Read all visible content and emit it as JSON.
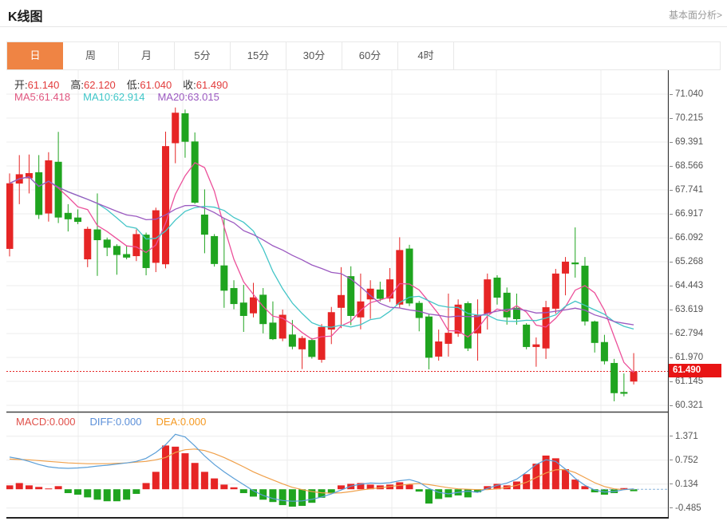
{
  "header": {
    "title": "K线图",
    "link": "基本面分析>"
  },
  "tabs": {
    "items": [
      "日",
      "周",
      "月",
      "5分",
      "15分",
      "30分",
      "60分",
      "4时"
    ],
    "active_index": 0,
    "active_bg": "#ef8444"
  },
  "legend": {
    "ohlc": [
      {
        "label": "开:",
        "value": "61.140"
      },
      {
        "label": "高:",
        "value": "62.120"
      },
      {
        "label": "低:",
        "value": "61.040"
      },
      {
        "label": "收:",
        "value": "61.490"
      }
    ],
    "ma": [
      {
        "label": "MA5:",
        "value": "61.418",
        "color": "#e0557f"
      },
      {
        "label": "MA10:",
        "value": "62.914",
        "color": "#3fc6c8"
      },
      {
        "label": "MA20:",
        "value": "63.015",
        "color": "#9b59c0"
      }
    ],
    "macd": [
      {
        "label": "MACD:",
        "value": "0.000",
        "color": "#e0504a"
      },
      {
        "label": "DIFF:",
        "value": "0.000",
        "color": "#5b8fd8"
      },
      {
        "label": "DEA:",
        "value": "0.000",
        "color": "#f59a23"
      }
    ]
  },
  "axis": {
    "main_tick_labels": [
      "71.040",
      "70.215",
      "69.391",
      "68.566",
      "67.741",
      "66.917",
      "66.092",
      "65.268",
      "64.443",
      "63.619",
      "62.794",
      "61.970",
      "61.145",
      "60.321"
    ],
    "macd_tick_labels": [
      "1.371",
      "0.752",
      "0.134",
      "-0.485"
    ],
    "current_price_label": "61.490"
  },
  "colors": {
    "up": "#e62525",
    "down": "#1fa41f",
    "grid": "#ececec",
    "axis_line": "#333333",
    "dotted_price": "#e62525",
    "badge_bg": "#e81414",
    "ma5": "#ec509a",
    "ma10": "#43c5c7",
    "ma20": "#9b59c0",
    "diff": "#5b9fd8",
    "dea": "#f0a04a"
  },
  "chart_data": {
    "type": "candlestick+macd",
    "title": "K线图 (daily K-line with MA5/MA10/MA20 overlays and MACD pane)",
    "price_axis": {
      "ticks": [
        71.04,
        70.215,
        69.391,
        68.566,
        67.741,
        66.917,
        66.092,
        65.268,
        64.443,
        63.619,
        62.794,
        61.97,
        61.145,
        60.321
      ],
      "current_price": 61.49
    },
    "macd_axis": {
      "ticks": [
        1.371,
        0.752,
        0.134,
        -0.485
      ]
    },
    "ohlc_latest": {
      "open": 61.14,
      "high": 62.12,
      "low": 61.04,
      "close": 61.49
    },
    "ma_latest": {
      "ma5": 61.418,
      "ma10": 62.914,
      "ma20": 63.015
    },
    "candles_ohlc": [
      [
        65.71,
        68.31,
        65.45,
        67.97
      ],
      [
        67.96,
        68.94,
        67.25,
        68.28
      ],
      [
        68.14,
        68.96,
        67.62,
        68.32
      ],
      [
        68.35,
        68.94,
        66.74,
        66.88
      ],
      [
        66.93,
        69.04,
        66.65,
        68.76
      ],
      [
        68.71,
        69.74,
        66.6,
        66.79
      ],
      [
        66.95,
        67.25,
        66.31,
        66.73
      ],
      [
        66.79,
        67.07,
        66.56,
        66.64
      ],
      [
        65.35,
        66.47,
        65.08,
        66.4
      ],
      [
        66.38,
        67.62,
        64.78,
        66.01
      ],
      [
        66.03,
        66.1,
        65.46,
        65.75
      ],
      [
        65.81,
        65.87,
        64.82,
        65.5
      ],
      [
        65.53,
        65.82,
        65.35,
        65.41
      ],
      [
        65.46,
        66.38,
        65.29,
        66.22
      ],
      [
        66.2,
        66.27,
        64.8,
        65.05
      ],
      [
        65.23,
        67.13,
        64.91,
        67.04
      ],
      [
        65.18,
        69.75,
        65.04,
        69.25
      ],
      [
        69.35,
        70.58,
        68.66,
        70.4
      ],
      [
        70.38,
        70.51,
        68.85,
        69.4
      ],
      [
        69.41,
        69.72,
        67.26,
        67.3
      ],
      [
        66.89,
        67.76,
        65.56,
        66.2
      ],
      [
        66.15,
        66.22,
        65.1,
        65.19
      ],
      [
        65.14,
        66.75,
        63.68,
        64.27
      ],
      [
        64.36,
        64.63,
        63.63,
        63.81
      ],
      [
        63.86,
        64.47,
        62.85,
        63.4
      ],
      [
        63.49,
        64.54,
        63.35,
        64.04
      ],
      [
        64.13,
        64.36,
        62.8,
        63.12
      ],
      [
        63.17,
        63.9,
        62.57,
        62.6
      ],
      [
        62.62,
        63.62,
        62.53,
        63.44
      ],
      [
        62.76,
        63.26,
        62.25,
        62.34
      ],
      [
        62.25,
        62.71,
        61.57,
        62.64
      ],
      [
        62.57,
        62.64,
        61.93,
        61.99
      ],
      [
        61.89,
        63.12,
        61.79,
        63.02
      ],
      [
        62.93,
        63.71,
        62.43,
        63.53
      ],
      [
        63.68,
        65.08,
        62.98,
        64.12
      ],
      [
        64.77,
        65.11,
        63.08,
        63.4
      ],
      [
        63.35,
        64.86,
        62.94,
        63.9
      ],
      [
        63.97,
        64.63,
        63.3,
        64.34
      ],
      [
        64.31,
        64.58,
        63.9,
        63.99
      ],
      [
        64.0,
        65.05,
        63.88,
        64.66
      ],
      [
        63.79,
        66.11,
        63.67,
        65.67
      ],
      [
        65.72,
        65.85,
        63.74,
        63.83
      ],
      [
        63.85,
        63.92,
        62.87,
        63.33
      ],
      [
        63.38,
        63.47,
        61.56,
        61.96
      ],
      [
        62.0,
        62.93,
        61.86,
        62.52
      ],
      [
        62.44,
        64.17,
        62.0,
        62.82
      ],
      [
        62.79,
        63.97,
        62.68,
        63.79
      ],
      [
        63.84,
        63.9,
        62.19,
        62.28
      ],
      [
        62.8,
        63.97,
        61.86,
        63.43
      ],
      [
        63.48,
        64.86,
        62.93,
        64.66
      ],
      [
        64.72,
        64.8,
        63.79,
        64.03
      ],
      [
        64.2,
        64.38,
        63.1,
        63.35
      ],
      [
        63.68,
        64.17,
        63.1,
        63.29
      ],
      [
        63.1,
        63.15,
        62.25,
        62.33
      ],
      [
        62.33,
        62.66,
        61.65,
        62.42
      ],
      [
        62.28,
        63.92,
        61.92,
        63.7
      ],
      [
        63.65,
        65.02,
        63.48,
        64.86
      ],
      [
        64.86,
        65.43,
        64.11,
        65.27
      ],
      [
        65.24,
        66.45,
        64.72,
        65.18
      ],
      [
        65.13,
        65.43,
        63.07,
        63.21
      ],
      [
        63.21,
        63.24,
        62.14,
        62.47
      ],
      [
        62.5,
        62.75,
        61.73,
        61.84
      ],
      [
        61.78,
        61.92,
        60.46,
        60.74
      ],
      [
        60.78,
        61.42,
        60.63,
        60.72
      ],
      [
        61.14,
        62.12,
        61.04,
        61.49
      ]
    ],
    "macd": {
      "hist": [
        0.1,
        0.16,
        0.1,
        0.06,
        0.02,
        0.08,
        -0.1,
        -0.14,
        -0.21,
        -0.27,
        -0.31,
        -0.31,
        -0.27,
        -0.12,
        0.16,
        0.45,
        1.13,
        1.1,
        0.93,
        0.68,
        0.45,
        0.28,
        0.12,
        0.05,
        -0.1,
        -0.19,
        -0.27,
        -0.33,
        -0.41,
        -0.45,
        -0.43,
        -0.35,
        -0.22,
        -0.1,
        0.1,
        0.14,
        0.16,
        0.12,
        0.1,
        0.12,
        0.18,
        0.12,
        -0.06,
        -0.37,
        -0.25,
        -0.21,
        -0.16,
        -0.21,
        -0.08,
        0.08,
        0.14,
        0.1,
        0.2,
        0.39,
        0.66,
        0.87,
        0.8,
        0.52,
        0.25,
        0.08,
        -0.08,
        -0.14,
        -0.1,
        0.03,
        -0.05
      ],
      "diff": [
        0.83,
        0.79,
        0.72,
        0.64,
        0.58,
        0.55,
        0.54,
        0.55,
        0.57,
        0.6,
        0.62,
        0.65,
        0.68,
        0.72,
        0.8,
        0.95,
        1.15,
        1.42,
        1.35,
        1.12,
        0.86,
        0.64,
        0.45,
        0.28,
        0.12,
        -0.04,
        -0.16,
        -0.24,
        -0.29,
        -0.31,
        -0.3,
        -0.26,
        -0.2,
        -0.12,
        -0.02,
        0.08,
        0.13,
        0.16,
        0.15,
        0.17,
        0.22,
        0.25,
        0.18,
        0.02,
        -0.08,
        -0.12,
        -0.08,
        -0.05,
        -0.08,
        0.02,
        0.1,
        0.16,
        0.26,
        0.44,
        0.64,
        0.76,
        0.72,
        0.52,
        0.28,
        0.1,
        -0.02,
        -0.07,
        -0.06,
        -0.01,
        0.01
      ],
      "dea": [
        0.78,
        0.77,
        0.76,
        0.74,
        0.72,
        0.7,
        0.68,
        0.67,
        0.66,
        0.66,
        0.66,
        0.67,
        0.68,
        0.7,
        0.72,
        0.76,
        0.82,
        0.95,
        1.02,
        1.04,
        1.0,
        0.92,
        0.82,
        0.7,
        0.58,
        0.45,
        0.34,
        0.24,
        0.14,
        0.05,
        -0.01,
        -0.06,
        -0.09,
        -0.1,
        -0.09,
        -0.06,
        -0.02,
        0.01,
        0.04,
        0.07,
        0.1,
        0.13,
        0.15,
        0.12,
        0.08,
        0.04,
        0.01,
        0.0,
        -0.01,
        -0.01,
        0.01,
        0.05,
        0.1,
        0.18,
        0.3,
        0.42,
        0.5,
        0.51,
        0.43,
        0.3,
        0.17,
        0.07,
        0.01,
        -0.01,
        0.0
      ]
    },
    "layout": {
      "grid": true,
      "legend_position": "top-left-inside",
      "ylim_main": [
        60.13,
        71.86
      ],
      "ylim_macd": [
        -0.72,
        1.94
      ]
    }
  }
}
